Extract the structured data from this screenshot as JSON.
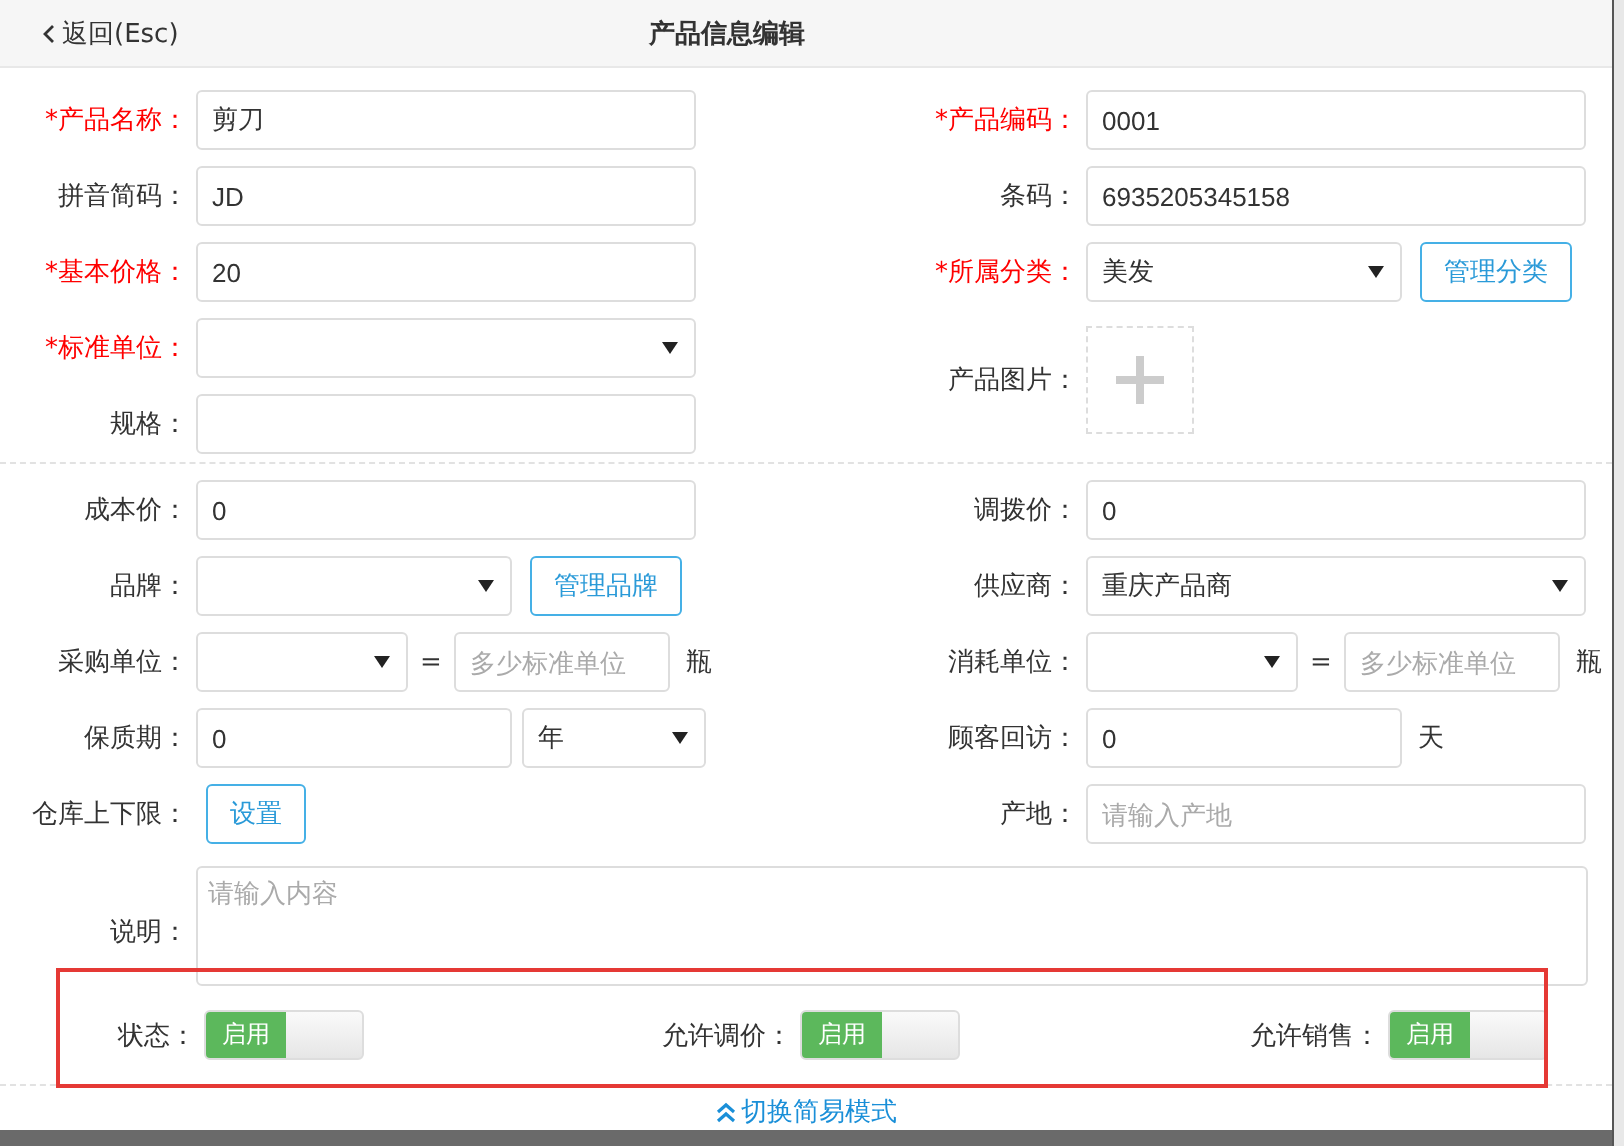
{
  "header": {
    "back": "返回(Esc)",
    "title": "产品信息编辑"
  },
  "basic": {
    "left": [
      {
        "label": "*产品名称：",
        "required": true,
        "kind": "text",
        "value": "剪刀"
      },
      {
        "label": "拼音简码：",
        "required": false,
        "kind": "text",
        "value": "JD"
      },
      {
        "label": "*基本价格：",
        "required": true,
        "kind": "text",
        "value": "20"
      },
      {
        "label": "*标准单位：",
        "required": true,
        "kind": "select"
      },
      {
        "label": "规格：",
        "required": false,
        "kind": "text"
      }
    ],
    "right": [
      {
        "label": "*产品编码：",
        "required": true,
        "kind": "text",
        "value": "0001"
      },
      {
        "label": "条码：",
        "required": false,
        "kind": "text",
        "value": "6935205345158"
      },
      {
        "label": "*所属分类：",
        "required": true,
        "kind": "select_button",
        "value": "美发",
        "button": "管理分类"
      },
      {
        "label": "产品图片：",
        "required": false,
        "kind": "image"
      }
    ]
  },
  "details": {
    "left": [
      {
        "label": "成本价：",
        "required": false,
        "kind": "text",
        "value": "0"
      },
      {
        "label": "品牌：",
        "required": false,
        "kind": "select_button",
        "button": "管理品牌"
      },
      {
        "label": "采购单位：",
        "required": false,
        "kind": "conversion",
        "equals": "=",
        "placeholder": "多少标准单位",
        "unit": "瓶"
      },
      {
        "label": "保质期：",
        "required": false,
        "kind": "text_select",
        "value": "0",
        "option": "年"
      },
      {
        "label": "仓库上下限：",
        "required": false,
        "kind": "button",
        "button": "设置"
      }
    ],
    "right": [
      {
        "label": "调拨价：",
        "required": false,
        "kind": "text",
        "value": "0"
      },
      {
        "label": "供应商：",
        "required": false,
        "kind": "select",
        "value": "重庆产品商"
      },
      {
        "label": "消耗单位：",
        "required": false,
        "kind": "conversion",
        "equals": "=",
        "placeholder": "多少标准单位",
        "unit": "瓶"
      },
      {
        "label": "顾客回访：",
        "required": false,
        "kind": "text_unit",
        "value": "0",
        "unit": "天"
      },
      {
        "label": "产地：",
        "required": false,
        "kind": "text",
        "placeholder": "请输入产地"
      }
    ]
  },
  "description": {
    "label": "说明：",
    "placeholder": "请输入内容"
  },
  "switches": {
    "highlighted": true,
    "items": [
      {
        "label": "状态：",
        "text": "启用",
        "on": true
      },
      {
        "label": "允许调价：",
        "text": "启用",
        "on": true
      },
      {
        "label": "允许销售：",
        "text": "启用",
        "on": true
      }
    ]
  },
  "footer_link": "切换简易模式"
}
